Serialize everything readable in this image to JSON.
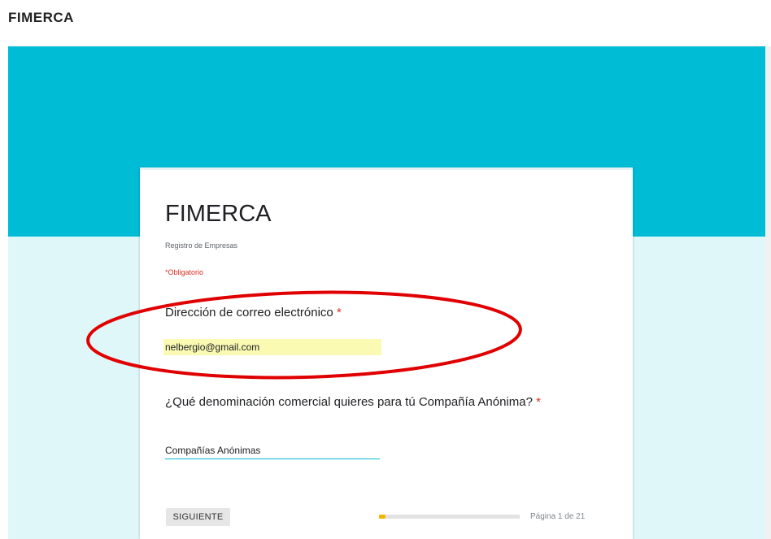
{
  "brand": "FIMERCA",
  "form": {
    "title": "FIMERCA",
    "description": "Registro de Empresas",
    "required_note": "*Obligatorio",
    "questions": [
      {
        "label": "Dirección de correo electrónico",
        "required_mark": "*",
        "answer": "nelbergio@gmail.com"
      },
      {
        "label": "¿Qué denominación comercial quieres para tú Compañía Anónima?",
        "required_mark": "*",
        "answer": "Compañías Anónimas"
      }
    ],
    "next_label": "SIGUIENTE",
    "page_indicator": "Página 1 de 21",
    "progress_fraction": 0.048
  },
  "colors": {
    "header_band": "#00bcd4",
    "background_band": "#e0f7fa",
    "annotation": "#e00000",
    "highlight": "#fafab3"
  }
}
